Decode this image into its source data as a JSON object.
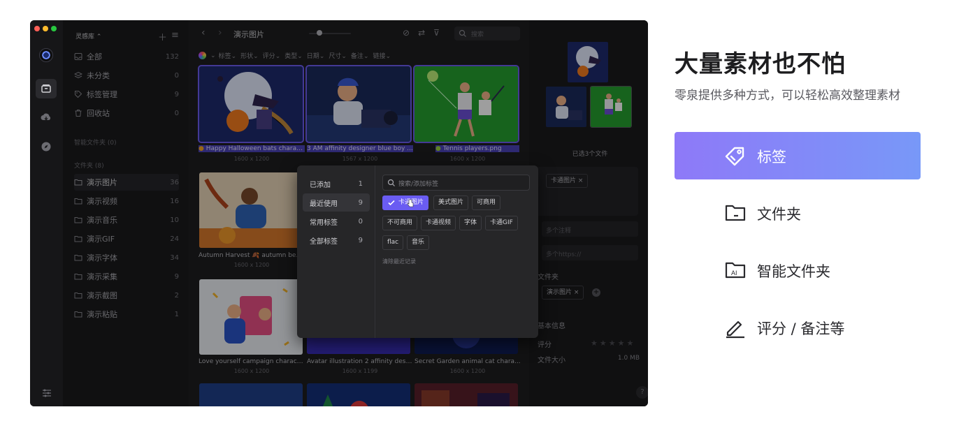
{
  "app": {
    "library_name": "灵感库",
    "sidebar": {
      "items": [
        {
          "label": "全部",
          "count": "132"
        },
        {
          "label": "未分类",
          "count": "0"
        },
        {
          "label": "标签管理",
          "count": "9"
        },
        {
          "label": "回收站",
          "count": "0"
        }
      ],
      "smart_folders_header": "智能文件夹 (0)",
      "folders_header": "文件夹 (8)",
      "folders": [
        {
          "label": "演示图片",
          "count": "36"
        },
        {
          "label": "演示视频",
          "count": "16"
        },
        {
          "label": "演示音乐",
          "count": "10"
        },
        {
          "label": "演示GIF",
          "count": "24"
        },
        {
          "label": "演示字体",
          "count": "34"
        },
        {
          "label": "演示采集",
          "count": "9"
        },
        {
          "label": "演示截图",
          "count": "2"
        },
        {
          "label": "演示粘贴",
          "count": "1"
        }
      ]
    },
    "toolbar": {
      "title": "演示图片",
      "search_placeholder": "搜索"
    },
    "filters": [
      "标签",
      "形状",
      "评分",
      "类型",
      "日期",
      "尺寸",
      "备注",
      "链接"
    ],
    "grid": [
      {
        "name": "Happy Halloween bats charac...",
        "size": "1600 x 1200",
        "selected": true
      },
      {
        "name": "3 AM affinity designer blue boy ...",
        "size": "1567 x 1200",
        "selected": true
      },
      {
        "name": "Tennis players.png",
        "size": "1600 x 1200",
        "selected": true
      },
      {
        "name": "Autumn Harvest 🍂 autumn be...",
        "size": "1600 x 1200",
        "selected": false
      },
      {
        "name": "Love yourself campaign charact...",
        "size": "1600 x 1200",
        "selected": false
      },
      {
        "name": "Avatar illustration 2 affinity desi...",
        "size": "1600 x 1199",
        "selected": false
      },
      {
        "name": "Secret Garden animal cat chara...",
        "size": "1600 x 1200",
        "selected": false
      }
    ],
    "inspector": {
      "selected_count": "已选3个文件",
      "tag_chip": "卡通图片",
      "note_placeholder": "多个注释",
      "link_placeholder": "多个https://",
      "folder_label": "文件夹",
      "folder_chip": "演示图片",
      "basic_info_label": "基本信息",
      "rating_label": "评分",
      "file_size_label": "文件大小",
      "file_size_value": "1.0 MB",
      "help": "?"
    },
    "tag_popup": {
      "categories": [
        {
          "label": "已添加",
          "count": "1"
        },
        {
          "label": "最近使用",
          "count": "9"
        },
        {
          "label": "常用标签",
          "count": "0"
        },
        {
          "label": "全部标签",
          "count": "9"
        }
      ],
      "search_placeholder": "搜索/添加标签",
      "tags": [
        {
          "label": "卡通图片",
          "checked": true
        },
        {
          "label": "美式图片",
          "checked": false
        },
        {
          "label": "可商用",
          "checked": false
        },
        {
          "label": "不可商用",
          "checked": false
        },
        {
          "label": "卡通视频",
          "checked": false
        },
        {
          "label": "字体",
          "checked": false
        },
        {
          "label": "卡通GIF",
          "checked": false
        },
        {
          "label": "flac",
          "checked": false
        },
        {
          "label": "音乐",
          "checked": false
        }
      ],
      "clear_recent": "清除最近记录"
    }
  },
  "marketing": {
    "title": "大量素材也不怕",
    "subtitle": "零泉提供多种方式，可以轻松高效整理素材",
    "features": [
      {
        "label": "标签",
        "icon": "tag-icon",
        "active": true
      },
      {
        "label": "文件夹",
        "icon": "folder-icon",
        "active": false
      },
      {
        "label": "智能文件夹",
        "icon": "smart-folder-icon",
        "active": false
      },
      {
        "label": "评分 / 备注等",
        "icon": "edit-pen-icon",
        "active": false
      }
    ],
    "colors": {
      "accent_start": "#8e79f8",
      "accent_end": "#7898f8",
      "tag_selected": "#6a5cf2"
    }
  }
}
